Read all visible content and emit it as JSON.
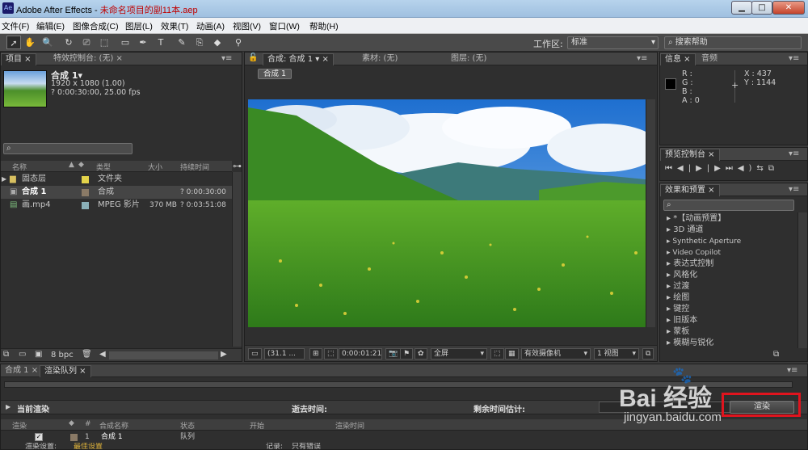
{
  "window": {
    "title_prefix": "Adobe After Effects - ",
    "title_file": "未命名项目的副11本.aep",
    "minimize": "▁",
    "maximize": "□",
    "close": "✕"
  },
  "menu": [
    "文件(F)",
    "编辑(E)",
    "图像合成(C)",
    "图层(L)",
    "效果(T)",
    "动画(A)",
    "视图(V)",
    "窗口(W)",
    "帮助(H)"
  ],
  "toolbar": {
    "workspace_label": "工作区:",
    "workspace_value": "标准",
    "search_help": "搜索帮助",
    "tools": [
      "➚",
      "✋",
      "🔍",
      "↻",
      "⎚",
      "⬚",
      "✒",
      "T",
      "✎",
      "⎘",
      "◆",
      "⚲"
    ]
  },
  "project_panel": {
    "tab_project": "项目",
    "tab_effect_controls": "特效控制台: (无)",
    "comp_name": "合成 1▾",
    "comp_size": "1920 x 1080 (1.00)",
    "comp_duration": "? 0:00:30:00, 25.00 fps",
    "columns": [
      "名称",
      "类型",
      "大小",
      "持续时间"
    ],
    "items": [
      {
        "name": "固态层",
        "type": "文件夹",
        "size": "",
        "duration": "",
        "color": "#e3d34a",
        "icon": "folder-icon"
      },
      {
        "name": "合成 1",
        "type": "合成",
        "size": "",
        "duration": "? 0:00:30:00",
        "color": "#8a7a66",
        "icon": "composition-icon"
      },
      {
        "name": "画.mp4",
        "type": "MPEG 影片",
        "size": "370 MB",
        "duration": "? 0:03:51:08",
        "color": "#8ab0b8",
        "icon": "video-file-icon"
      }
    ],
    "bpc": "8 bpc"
  },
  "composition_panel": {
    "tab_comp": "合成: 合成 1",
    "tab_footage": "素材: (无)",
    "tab_layer": "图层: (无)",
    "comp_button": "合成 1",
    "zoom": "(31.1 ...",
    "timecode": "0:00:01:21",
    "resolution": "全屏",
    "camera": "有效摄像机",
    "views": "1 视图"
  },
  "info_panel": {
    "tab_info": "信息",
    "tab_audio": "音频",
    "r": "R :",
    "g": "G :",
    "b": "B :",
    "a": "A : 0",
    "x": "X : 437",
    "y": "Y : 1144"
  },
  "preview_panel": {
    "title": "预览控制台",
    "buttons": [
      "⏮",
      "◀|",
      "▶",
      "|▶",
      "⏭",
      "◀)",
      "⇆",
      "⧉"
    ]
  },
  "effects_panel": {
    "title": "效果和预置",
    "search_placeholder": "",
    "items": [
      "*【动画预置】",
      "3D 通道",
      "Synthetic Aperture",
      "Video Copilot",
      "表达式控制",
      "风格化",
      "过渡",
      "绘图",
      "键控",
      "旧版本",
      "蒙板",
      "模糊与锐化"
    ]
  },
  "bottom_panel": {
    "tab_comp": "合成 1",
    "tab_render": "渲染队列",
    "current_render": "当前渲染",
    "elapsed": "逝去时间:",
    "remaining": "剩余时间估计:",
    "render_button": "渲染",
    "columns": [
      "渲染",
      "#",
      "合成名称",
      "状态",
      "开始",
      "渲染时间"
    ],
    "rows": [
      {
        "index": "1",
        "name": "合成 1",
        "status": "队列"
      }
    ],
    "settings_label": "渲染设置:",
    "settings_value": "最佳设置",
    "log_label": "记录:",
    "log_value": "只有错误"
  },
  "watermark": {
    "brand": "Bai  经验",
    "url": "jingyan.baidu.com"
  }
}
